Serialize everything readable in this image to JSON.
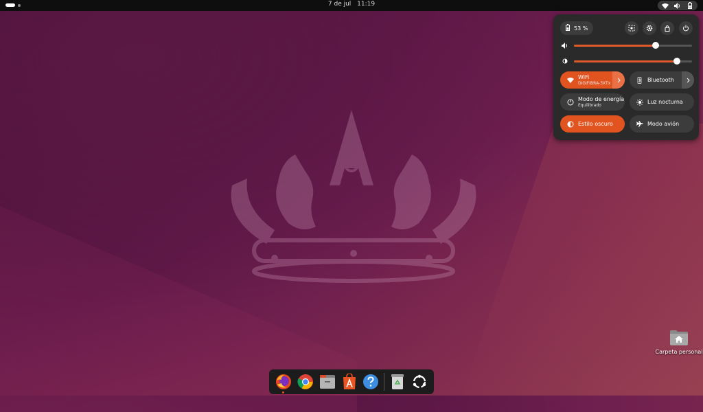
{
  "topbar": {
    "date": "7 de jul",
    "time": "11:19",
    "tray_icons": [
      "wifi-icon",
      "volume-icon",
      "battery-icon"
    ]
  },
  "quick_settings": {
    "battery_label": "53 %",
    "buttons": [
      "screenshot-icon",
      "settings-icon",
      "lock-icon",
      "power-icon"
    ],
    "volume_level": 0.69,
    "brightness_level": 0.87,
    "tiles": {
      "wifi": {
        "title": "WiFi",
        "subtitle": "DIGIFIBRA-3XTx",
        "active": true
      },
      "bluetooth": {
        "title": "Bluetooth",
        "active": false
      },
      "power_mode": {
        "title": "Modo de energía",
        "subtitle": "Equilibrado",
        "active": false
      },
      "night_light": {
        "title": "Luz nocturna",
        "active": false
      },
      "dark_style": {
        "title": "Estilo oscuro",
        "active": true
      },
      "airplane": {
        "title": "Modo avión",
        "active": false
      }
    },
    "accent": "#e2541f"
  },
  "desktop": {
    "home_folder_label": "Carpeta personal"
  },
  "dock": {
    "apps": [
      "firefox",
      "chrome",
      "files",
      "app-center",
      "help",
      "trash",
      "show-apps"
    ]
  }
}
